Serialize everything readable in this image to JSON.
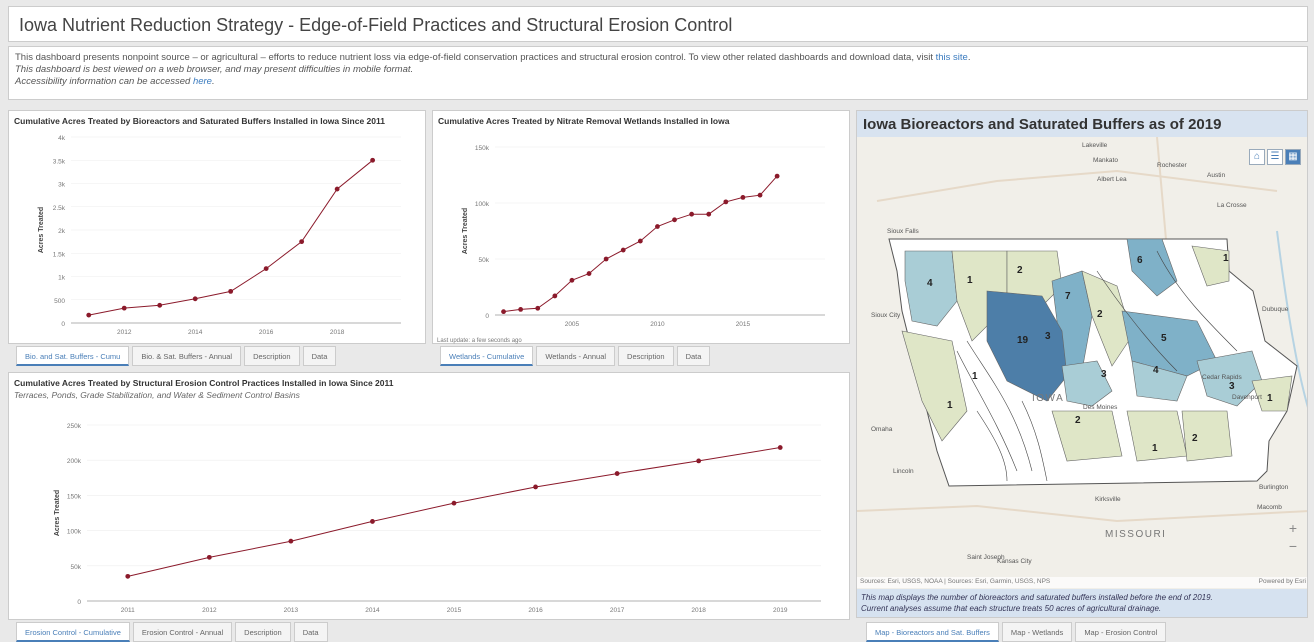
{
  "header": {
    "title": "Iowa Nutrient Reduction Strategy - Edge-of-Field Practices and Structural Erosion Control"
  },
  "info": {
    "line1": "This dashboard presents nonpoint source – or agricultural – efforts to reduce nutrient loss via edge-of-field conservation practices and structural erosion control. To view other related dashboards and download data, visit ",
    "line1_link": "this site",
    "line2": "This dashboard is best viewed on a web browser, and may present difficulties in mobile format.",
    "line3": "Accessibility information can be accessed ",
    "line3_link": "here"
  },
  "panel1": {
    "tabs": [
      "Bio. and Sat. Buffers - Cumu",
      "Bio. & Sat. Buffers - Annual",
      "Description",
      "Data"
    ]
  },
  "panel2": {
    "last_update": "Last update: a few seconds ago",
    "tabs": [
      "Wetlands - Cumulative",
      "Wetlands - Annual",
      "Description",
      "Data"
    ]
  },
  "panel3": {
    "subtitle": "Terraces, Ponds, Grade Stabilization, and Water & Sediment Control Basins",
    "tabs": [
      "Erosion Control - Cumulative",
      "Erosion Control - Annual",
      "Description",
      "Data"
    ]
  },
  "map": {
    "title": "Iowa Bioreactors and Saturated Buffers as of 2019",
    "attribution": "Sources: Esri, USGS, NOAA | Sources: Esri, Garmin, USGS, NPS",
    "powered": "Powered by Esri",
    "caption1": "This map displays the number of bioreactors and saturated buffers installed before the end of 2019.",
    "caption2": "Current analyses assume that each structure treats 50 acres of agricultural drainage.",
    "tabs": [
      "Map - Bioreactors and Sat. Buffers",
      "Map - Wetlands",
      "Map - Erosion Control"
    ],
    "places": [
      "Lakeville",
      "Mankato",
      "Rochester",
      "Albert Lea",
      "Austin",
      "La Crosse",
      "Sioux Falls",
      "Sioux City",
      "IOWA",
      "Des Moines",
      "Dubuque",
      "Cedar Rapids",
      "Davenport",
      "Omaha",
      "Lincoln",
      "Kansas City",
      "Kirksville",
      "Burlington",
      "Macomb",
      "MISSOURI",
      "Saint Joseph"
    ],
    "region_counts": [
      "4",
      "1",
      "2",
      "6",
      "1",
      "7",
      "2",
      "19",
      "3",
      "5",
      "4",
      "3",
      "1",
      "3",
      "1",
      "1",
      "2",
      "1",
      "2"
    ],
    "colors": {
      "high": "#4d7ea8",
      "mid": "#7fb1c8",
      "low": "#a9cdd6",
      "one": "#dfe6c7"
    }
  },
  "chart_data": [
    {
      "type": "line",
      "title": "Cumulative Acres Treated by Bioreactors and Saturated Buffers Installed in Iowa Since 2011",
      "xlabel": "",
      "ylabel": "Acres Treated",
      "x_ticks": [
        "2012",
        "2014",
        "2016",
        "2018"
      ],
      "y_ticks": [
        "0",
        "500",
        "1k",
        "1.5k",
        "2k",
        "2.5k",
        "3k",
        "3.5k",
        "4k"
      ],
      "x": [
        2011,
        2012,
        2013,
        2014,
        2015,
        2016,
        2017,
        2018,
        2019
      ],
      "y": [
        170,
        320,
        380,
        520,
        680,
        1170,
        1750,
        2880,
        3500
      ],
      "xlim": [
        2010.5,
        2019.8
      ],
      "ylim": [
        0,
        4000
      ],
      "color": "#8b1a2b"
    },
    {
      "type": "line",
      "title": "Cumulative Acres Treated by Nitrate Removal Wetlands Installed in Iowa",
      "xlabel": "",
      "ylabel": "Acres Treated",
      "x_ticks": [
        "2005",
        "2010",
        "2015"
      ],
      "y_ticks": [
        "0",
        "50k",
        "100k",
        "150k"
      ],
      "x": [
        2001,
        2002,
        2003,
        2004,
        2005,
        2006,
        2007,
        2008,
        2009,
        2010,
        2011,
        2012,
        2013,
        2014,
        2015,
        2016,
        2017,
        2018,
        2019
      ],
      "y": [
        3000,
        5000,
        6000,
        17000,
        31000,
        37000,
        50000,
        58000,
        66000,
        79000,
        85000,
        90000,
        90000,
        101000,
        105000,
        107000,
        124000
      ],
      "xlim": [
        2000.5,
        2019.8
      ],
      "ylim": [
        0,
        150000
      ],
      "color": "#8b1a2b"
    },
    {
      "type": "line",
      "title": "Cumulative Acres Treated by Structural Erosion Control Practices Installed in Iowa Since 2011",
      "xlabel": "",
      "ylabel": "Acres Treated",
      "x_ticks": [
        "2011",
        "2012",
        "2013",
        "2014",
        "2015",
        "2016",
        "2017",
        "2018",
        "2019"
      ],
      "y_ticks": [
        "0",
        "50k",
        "100k",
        "150k",
        "200k",
        "250k"
      ],
      "x": [
        2011,
        2012,
        2013,
        2014,
        2015,
        2016,
        2017,
        2018,
        2019
      ],
      "y": [
        35000,
        62000,
        85000,
        113000,
        139000,
        162000,
        181000,
        199000,
        218000
      ],
      "xlim": [
        2010.5,
        2019.5
      ],
      "ylim": [
        0,
        250000
      ],
      "color": "#8b1a2b"
    }
  ]
}
